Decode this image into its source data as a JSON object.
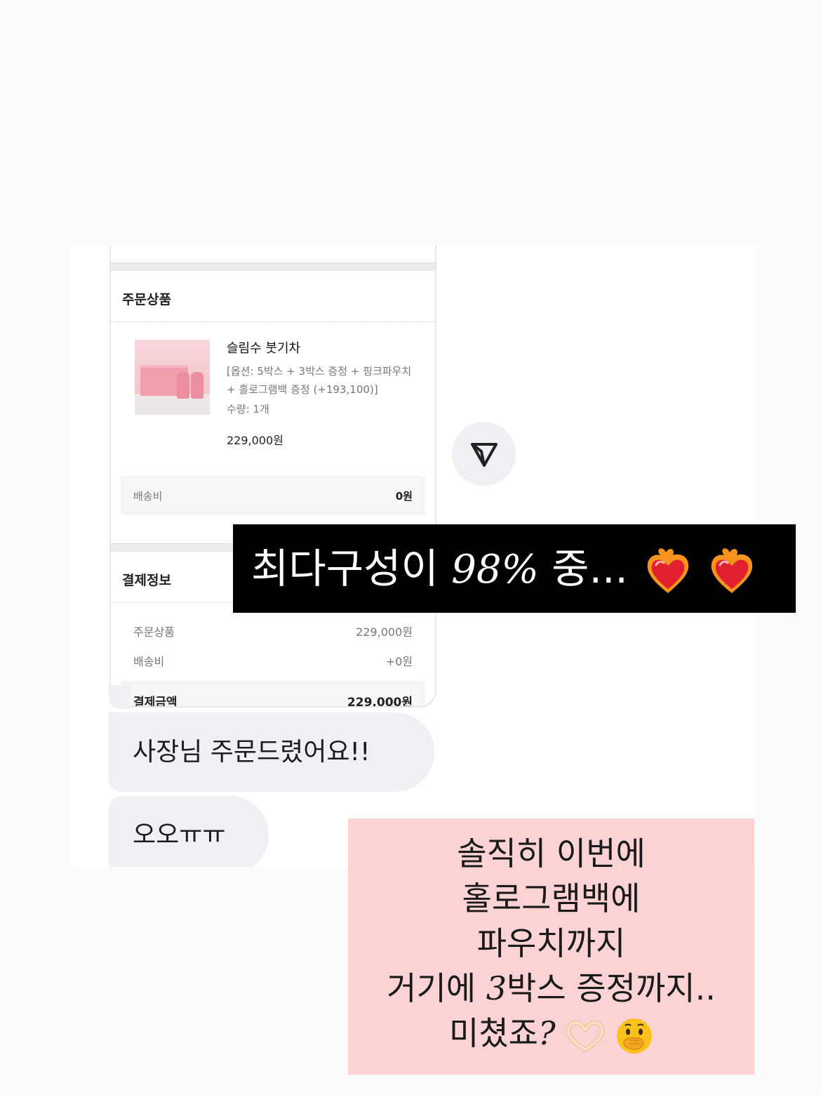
{
  "order": {
    "section_title": "주문상품",
    "product_name": "슬림수 붓기차",
    "option_line1": "[옵션: 5박스 + 3박스 증정 + 핑크파우치",
    "option_line2": "+ 홀로그램백 증정 (+193,100)]",
    "quantity": "수량: 1개",
    "price": "229,000원",
    "shipping_label": "배송비",
    "shipping_value": "0원"
  },
  "payment": {
    "section_title": "결제정보",
    "rows": [
      {
        "label": "주문상품",
        "value": "229,000원"
      },
      {
        "label": "배송비",
        "value": "+0원"
      }
    ],
    "total_label": "결제금액",
    "total_value": "229,000원"
  },
  "chat": {
    "messages": [
      "사장님 주문드렸어요!!",
      "오오ㅠㅠ"
    ]
  },
  "overlay_black": {
    "text_before": "최다구성이 ",
    "percent": "98%",
    "text_after": " 중..."
  },
  "overlay_pink": {
    "line1": "솔직히 이번에",
    "line2": "홀로그램백에",
    "line3": "파우치까지",
    "line4_pre": "거기에 ",
    "line4_num": "3",
    "line4_post": "박스 증정까지..",
    "line5_text": "미쳤죠",
    "line5_mark": "?"
  },
  "icons": {
    "send": "send-arrow-icon",
    "hearts": "heart-on-fire-icon",
    "hands": "heart-hands-icon",
    "face": "face-with-hand-over-mouth-icon"
  },
  "colors": {
    "pink_caption_bg": "#fcd3d4",
    "bubble_bg": "#eff0f3",
    "heart_red": "#e0202f",
    "flame_orange": "#f7941d"
  }
}
